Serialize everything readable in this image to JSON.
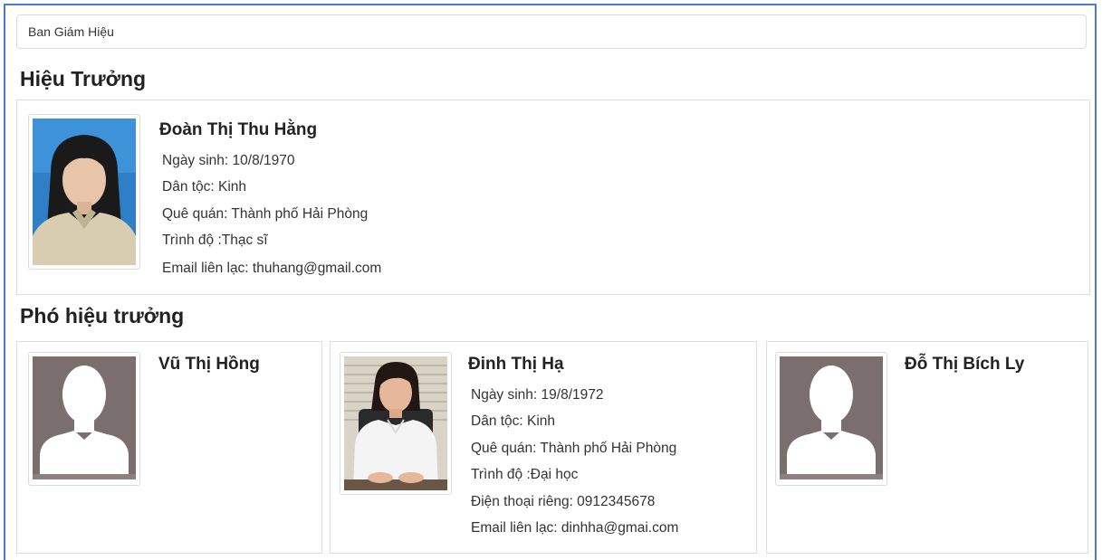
{
  "breadcrumb": "Ban Giám Hiệu",
  "principal_section": {
    "title": "Hiệu Trưởng",
    "person": {
      "name": "Đoàn Thị Thu Hằng",
      "lines": [
        "Ngày sinh: 10/8/1970",
        "Dân tộc: Kinh",
        "Quê quán: Thành phố Hải Phòng",
        "Trình độ :Thạc sĩ",
        "Email liên lạc: thuhang@gmail.com"
      ],
      "photo": "portrait-photo"
    }
  },
  "vice_section": {
    "title": "Phó hiệu trưởng",
    "people": [
      {
        "name": "Vũ Thị Hồng",
        "lines": [],
        "photo": "placeholder-avatar"
      },
      {
        "name": "Đinh Thị Hạ",
        "lines": [
          "Ngày sinh: 19/8/1972",
          "Dân tộc: Kinh",
          "Quê quán: Thành phố Hải Phòng",
          "Trình độ :Đại học",
          "Điện thoại riêng: 0912345678",
          "Email liên lạc: dinhha@gmai.com"
        ],
        "photo": "portrait-photo"
      },
      {
        "name": "Đỗ Thị Bích Ly",
        "lines": [],
        "photo": "placeholder-avatar"
      }
    ]
  },
  "colors": {
    "frame_border": "#4a7bd0",
    "placeholder_bg": "#7a6e6e"
  }
}
